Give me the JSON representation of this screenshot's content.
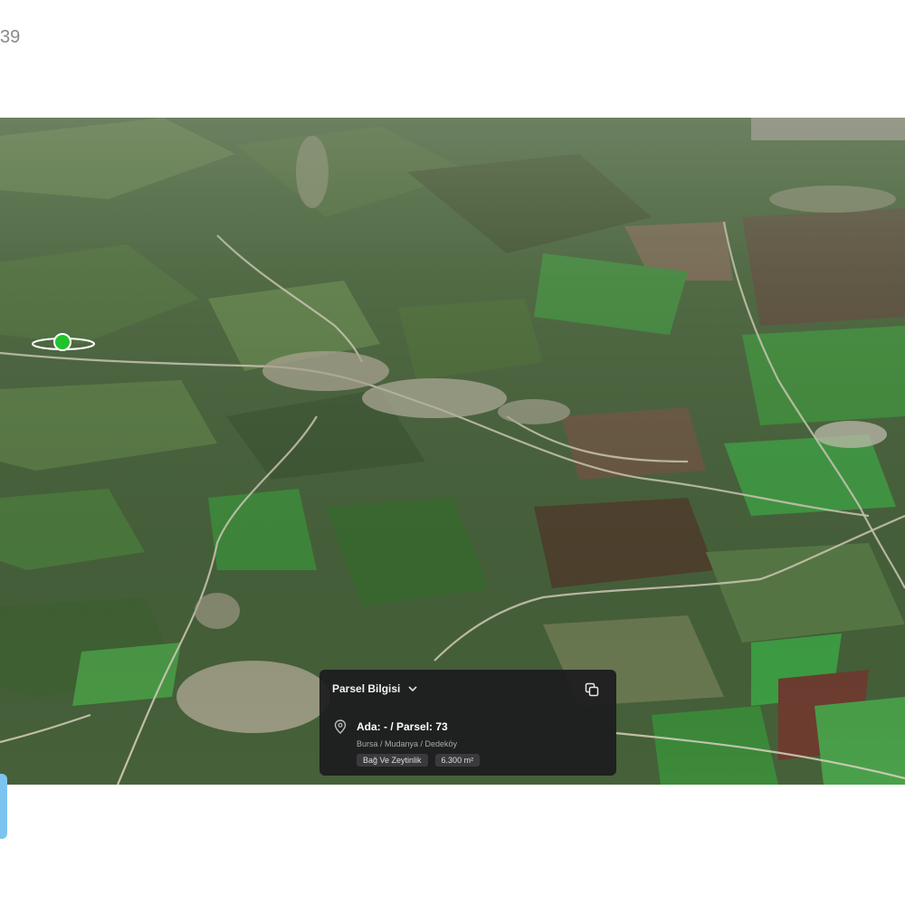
{
  "corner_label": "39",
  "parcel_panel": {
    "title": "Parsel Bilgisi",
    "parcel_id": "Ada: - / Parsel: 73",
    "location": "Bursa / Mudanya / Dedeköy",
    "land_type": "Bağ Ve Zeytinlik",
    "area": "6.300 m²"
  },
  "icons": {
    "chevron": "chevron-down-icon",
    "copy": "copy-icon",
    "pin": "location-pin-icon",
    "marker": "green-location-marker-icon"
  },
  "colors": {
    "panel_bg": "#1c1c1e",
    "marker_green": "#22c22a",
    "edge_marker": "#7cc4f0"
  }
}
